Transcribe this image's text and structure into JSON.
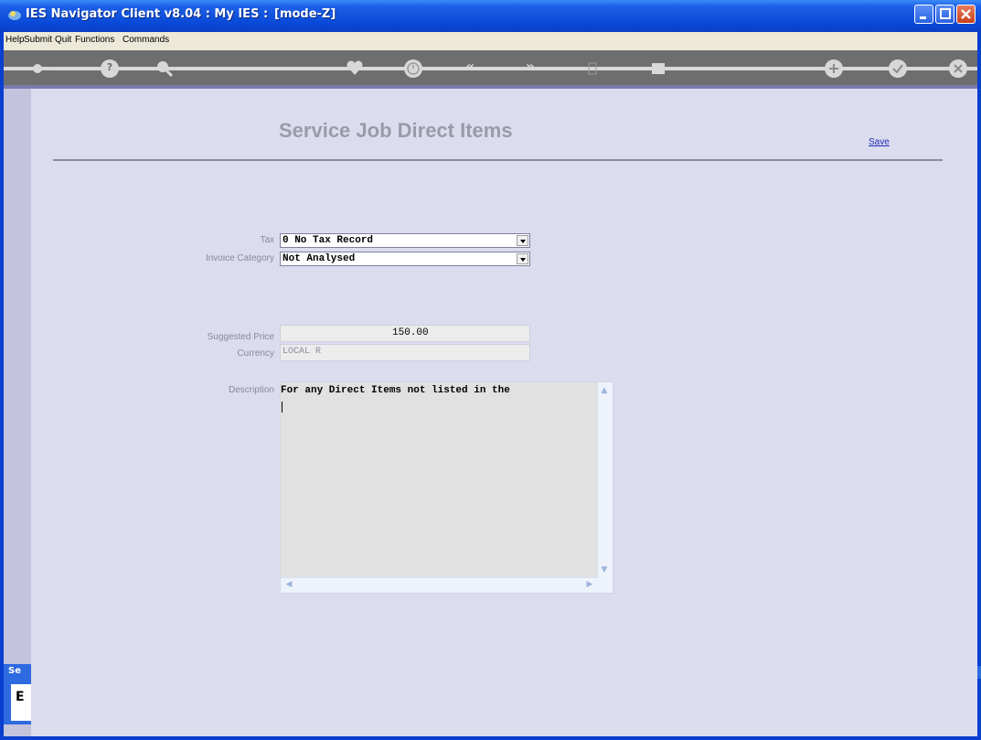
{
  "window": {
    "title": "IES Navigator Client v8.04 : My IES :",
    "mode": "[mode-Z]"
  },
  "menu": {
    "items": [
      "Help",
      "Submit",
      "Quit",
      "Functions",
      "Commands"
    ]
  },
  "toolbar": {
    "buttons": [
      {
        "icon": "key-icon"
      },
      {
        "icon": "help-icon",
        "glyph": "?"
      },
      {
        "icon": "search-icon"
      },
      {
        "icon": "heart-icon"
      },
      {
        "icon": "clock-icon"
      },
      {
        "icon": "rewind-icon",
        "glyph": "«"
      },
      {
        "icon": "forward-icon",
        "glyph": "»"
      },
      {
        "icon": "document-icon"
      },
      {
        "icon": "stop-icon"
      },
      {
        "icon": "add-icon"
      },
      {
        "icon": "check-icon"
      },
      {
        "icon": "close-icon"
      }
    ]
  },
  "page": {
    "title": "Service Job Direct Items",
    "save_label": "Save"
  },
  "form": {
    "tax_label": "Tax",
    "tax_value": "0 No Tax Record",
    "invoice_category_label": "Invoice Category",
    "invoice_category_value": "Not Analysed",
    "suggested_price_label": "Suggested Price",
    "suggested_price_value": "150.00",
    "currency_label": "Currency",
    "currency_value": "LOCAL R",
    "description_label": "Description",
    "description_value": "For any Direct Items not listed in the"
  },
  "side_tab": {
    "label": "Se",
    "char": "E"
  },
  "colors": {
    "title_bar": "#0a4ad8",
    "content_bg": "#dcdcef",
    "toolbar_bg": "#6e6e6e",
    "link": "#1a2fb0"
  }
}
